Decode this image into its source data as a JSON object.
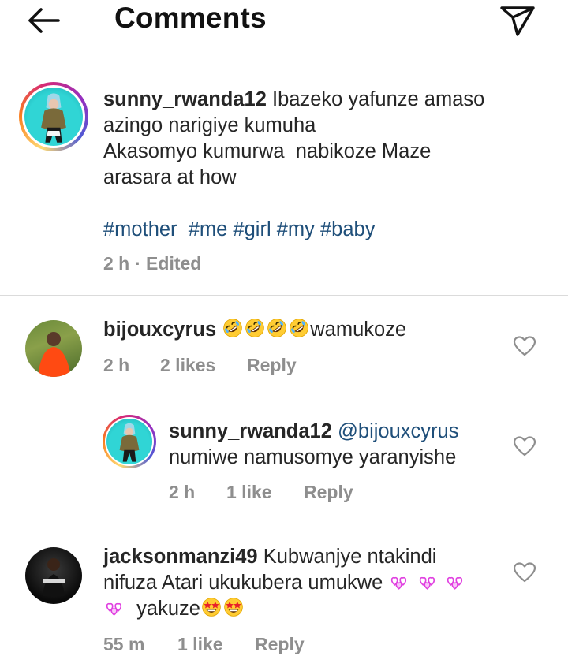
{
  "header": {
    "title": "Comments",
    "back_icon": "arrow-left-icon",
    "share_icon": "paper-plane-icon"
  },
  "caption": {
    "username": "sunny_rwanda12",
    "lines": [
      "Ibazeko yafunze amaso",
      "azingo narigiye kumuha",
      "Akasomyo kumurwa  nabikoze Maze",
      "arasara at how"
    ],
    "hashtags": [
      "#mother",
      "#me",
      "#girl",
      "#my",
      "#baby"
    ],
    "time": "2 h",
    "edited": "· Edited"
  },
  "comments": [
    {
      "username": "bijouxcyrus",
      "text": "wamukoze",
      "emoji_before": "rolling-on-floor-laughing x4",
      "time": "2 h",
      "likes": "2 likes",
      "reply": "Reply"
    },
    {
      "username": "sunny_rwanda12",
      "mention": "@bijouxcyrus",
      "text": "numiwe namusomye yaranyishe",
      "time": "2 h",
      "likes": "1 like",
      "reply": "Reply"
    },
    {
      "username": "jacksonmanzi49",
      "line1": "Kubwanjye ntakindi",
      "line2": "nifuza Atari ukukubera umukwe",
      "line3": "yakuze",
      "emoji_notes": "revolving-hearts, star-struck",
      "time": "55 m",
      "likes": "1 like",
      "reply": "Reply"
    }
  ],
  "colors": {
    "text": "#262626",
    "meta": "#8e8e8e",
    "hashtag": "#1f4f7a",
    "divider": "#dbdbdb"
  }
}
